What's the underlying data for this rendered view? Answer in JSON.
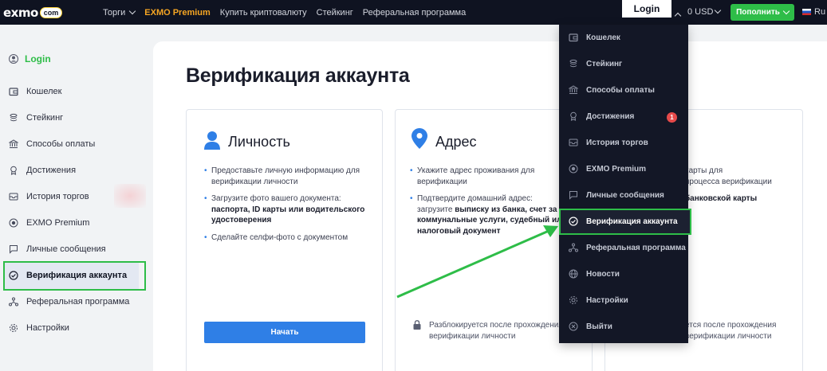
{
  "topbar": {
    "logo_text": "exmo",
    "logo_badge": "com",
    "nav": [
      {
        "label": "Торги",
        "has_chevron": true
      },
      {
        "label": "EXMO Premium"
      },
      {
        "label": "Купить криптовалюту"
      },
      {
        "label": "Стейкинг"
      },
      {
        "label": "Реферальная программа"
      }
    ],
    "username": "Login",
    "balance": "0 USD",
    "deposit_label": "Пополнить",
    "language": "Ru"
  },
  "sidebar": {
    "username": "Login",
    "items": [
      {
        "label": "Кошелек",
        "icon": "wallet-icon"
      },
      {
        "label": "Стейкинг",
        "icon": "stack-icon"
      },
      {
        "label": "Способы оплаты",
        "icon": "bank-icon"
      },
      {
        "label": "Достижения",
        "icon": "award-icon"
      },
      {
        "label": "История торгов",
        "icon": "history-icon"
      },
      {
        "label": "EXMO Premium",
        "icon": "premium-icon"
      },
      {
        "label": "Личные сообщения",
        "icon": "message-icon"
      },
      {
        "label": "Верификация аккаунта",
        "icon": "check-circle-icon",
        "active": true
      },
      {
        "label": "Реферальная программа",
        "icon": "referral-icon"
      },
      {
        "label": "Настройки",
        "icon": "gear-icon"
      }
    ]
  },
  "main": {
    "title": "Верификация аккаунта",
    "cards": [
      {
        "title": "Личность",
        "icon": "person-icon",
        "bullets": [
          [
            "Предоставьте личную информацию для верификации личности"
          ],
          [
            "Загрузите фото вашего документа: ",
            {
              "b": "паспорта, ID карты или водительского удостоверения"
            }
          ],
          [
            "Сделайте селфи-фото с документом"
          ]
        ],
        "button": "Начать"
      },
      {
        "title": "Адрес",
        "icon": "location-pin-icon",
        "bullets": [
          [
            "Укажите адрес проживания для верификации"
          ],
          [
            "Подтвердите домашний адрес: загрузите ",
            {
              "b": "выписку из банка, счет за коммунальные услуги, судебный или налоговый документ"
            }
          ]
        ],
        "locked_text": "Разблокируется после прохождения верификации личности"
      },
      {
        "title": "",
        "bullets_visible": [
          "карты для",
          "процесса верификации",
          "банковской карты"
        ],
        "locked_text": "ется после прохождения верификации личности"
      }
    ]
  },
  "dropdown": {
    "items": [
      {
        "label": "Кошелек",
        "icon": "wallet-icon"
      },
      {
        "label": "Стейкинг",
        "icon": "stack-icon"
      },
      {
        "label": "Способы оплаты",
        "icon": "bank-icon"
      },
      {
        "label": "Достижения",
        "icon": "award-icon",
        "badge": "1"
      },
      {
        "label": "История торгов",
        "icon": "history-icon"
      },
      {
        "label": "EXMO Premium",
        "icon": "premium-icon"
      },
      {
        "label": "Личные сообщения",
        "icon": "message-icon"
      },
      {
        "label": "Верификация аккаунта",
        "icon": "check-circle-icon",
        "active": true
      },
      {
        "label": "Реферальная программа",
        "icon": "referral-icon"
      },
      {
        "label": "Новости",
        "icon": "globe-icon"
      },
      {
        "label": "Настройки",
        "icon": "gear-icon"
      },
      {
        "label": "Выйти",
        "icon": "logout-icon"
      }
    ]
  },
  "colors": {
    "accent_green": "#2ebd48",
    "primary_blue": "#2f7fe6",
    "navbar_bg": "#0f1321",
    "premium_orange": "#f6a623",
    "badge_red": "#e64a4a"
  }
}
